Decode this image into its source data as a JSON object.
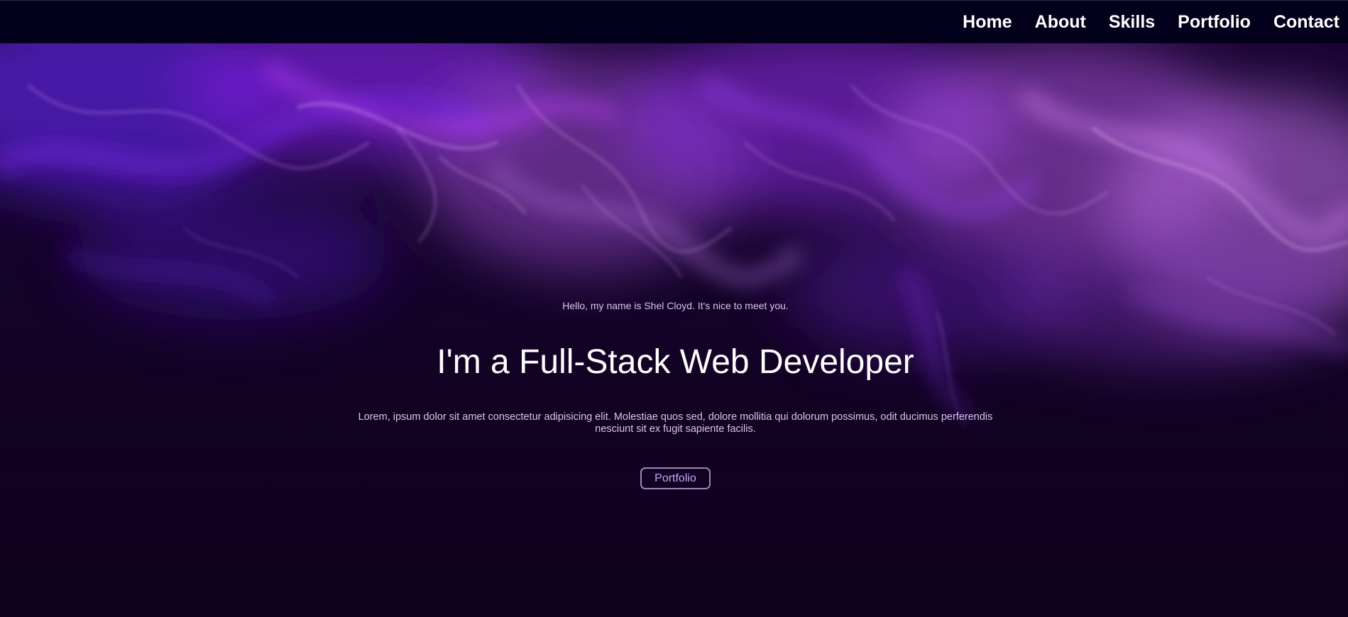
{
  "nav": {
    "items": [
      {
        "label": "Home"
      },
      {
        "label": "About"
      },
      {
        "label": "Skills"
      },
      {
        "label": "Portfolio"
      },
      {
        "label": "Contact"
      }
    ]
  },
  "hero": {
    "greeting": "Hello, my name is Shel Cloyd. It's nice to meet you.",
    "headline": "I'm a Full-Stack Web Developer",
    "description": "Lorem, ipsum dolor sit amet consectetur adipisicing elit. Molestiae quos sed, dolore mollitia qui dolorum possimus, odit ducimus perferendis nesciunt sit ex fugit sapiente facilis.",
    "button_label": "Portfolio"
  },
  "colors": {
    "nav_background": "#02001a",
    "hero_background": "#120322",
    "accent_purple": "#9b3cff",
    "button_text": "#c9a6ff"
  }
}
